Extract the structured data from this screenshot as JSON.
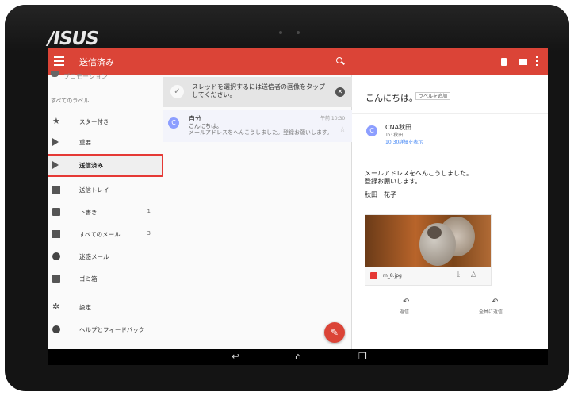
{
  "device": {
    "brand": "/ISUS"
  },
  "appbar": {
    "title": "送信済み"
  },
  "drawer": {
    "partial_item": "プロモーション",
    "section_label": "すべてのラベル",
    "items": [
      {
        "label": "スター付き",
        "count": ""
      },
      {
        "label": "重要",
        "count": ""
      },
      {
        "label": "送信済み",
        "count": ""
      },
      {
        "label": "送信トレイ",
        "count": ""
      },
      {
        "label": "下書き",
        "count": "1"
      },
      {
        "label": "すべてのメール",
        "count": "3"
      },
      {
        "label": "迷惑メール",
        "count": ""
      },
      {
        "label": "ゴミ箱",
        "count": ""
      },
      {
        "label": "設定",
        "count": ""
      },
      {
        "label": "ヘルプとフィードバック",
        "count": ""
      }
    ]
  },
  "list": {
    "tip": "スレッドを選択するには送信者の画像をタップしてください。",
    "message": {
      "avatar": "C",
      "sender": "自分",
      "time": "午前 10:30",
      "subject": "こんにちは。",
      "snippet": "メールアドレスをへんこうしました。登録お願いします。"
    }
  },
  "detail": {
    "subject": "こんにちは。",
    "label_button": "ラベルを追加",
    "avatar": "C",
    "sender": "CNA秋田",
    "to": "To: 秋田",
    "time": "10:30詳細を表示",
    "body1": "メールアドレスをへんこうしました。",
    "body2": "登録お願いします。",
    "body3": "秋田　花子",
    "attachment_name": "m_8.jpg",
    "reply": "返信",
    "reply_all": "全員に返信"
  },
  "colors": {
    "accent": "#db4437",
    "avatar": "#8c9eff",
    "highlight": "#e53935"
  }
}
